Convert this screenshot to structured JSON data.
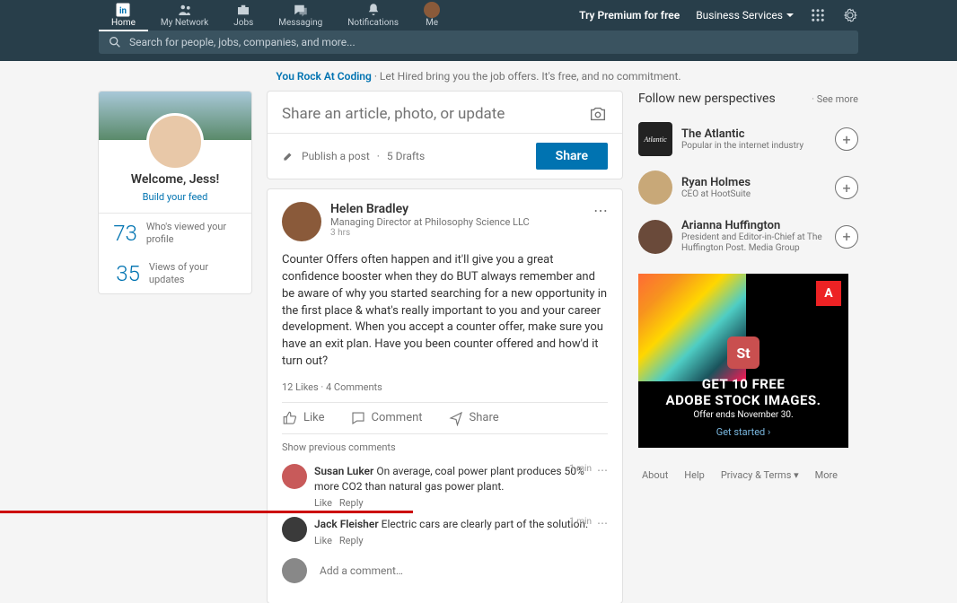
{
  "nav": {
    "home": "Home",
    "network": "My Network",
    "jobs": "Jobs",
    "messaging": "Messaging",
    "notifications": "Notifications",
    "me": "Me",
    "premium": "Try Premium for free",
    "business": "Business Services"
  },
  "search": {
    "placeholder": "Search for people, jobs, companies, and more..."
  },
  "promo": {
    "link": "You Rock At Coding",
    "text": " · Let Hired bring you the job offers. It's free, and no commitment."
  },
  "profile": {
    "welcome": "Welcome, Jess!",
    "build": "Build your feed",
    "stats": [
      {
        "num": "73",
        "label": "Who's viewed your profile"
      },
      {
        "num": "35",
        "label": "Views of your updates"
      }
    ]
  },
  "share": {
    "title": "Share an article, photo, or update",
    "publish": "Publish a post",
    "drafts": "5 Drafts",
    "button": "Share"
  },
  "post": {
    "author": "Helen Bradley",
    "headline": "Managing Director at Philosophy Science LLC",
    "time": "3 hrs",
    "body": "Counter Offers often happen and it'll give you a great confidence booster when they do BUT always remember and be aware of why you started searching for a new opportunity in the first place & what's really important to you and your career development. When you accept a counter offer, make sure you have an exit plan. Have you been counter offered and how'd it turn out?",
    "likes": "12 Likes",
    "comments_count": "4 Comments",
    "actions": {
      "like": "Like",
      "comment": "Comment",
      "share": "Share"
    },
    "prev": "Show previous comments",
    "comments": [
      {
        "author": "Susan Luker",
        "text": "On average, coal power plant produces 50% more CO2 than natural gas power plant.",
        "time": "1 min",
        "like": "Like",
        "reply": "Reply"
      },
      {
        "author": "Jack Fleisher",
        "text": "Electric cars are clearly part of the solution.",
        "time": "1 min",
        "like": "Like",
        "reply": "Reply"
      }
    ],
    "add_placeholder": "Add a comment…"
  },
  "follow": {
    "title": "Follow new perspectives",
    "see_more": "See more",
    "items": [
      {
        "name": "The Atlantic",
        "sub": "Popular in the internet industry"
      },
      {
        "name": "Ryan Holmes",
        "sub": "CEO at HootSuite"
      },
      {
        "name": "Arianna Huffington",
        "sub": "President and Editor-in-Chief at The Huffington Post. Media Group"
      }
    ]
  },
  "ad": {
    "logo": "A",
    "st": "St",
    "line1": "GET 10 FREE",
    "line2": "ADOBE STOCK IMAGES.",
    "offer": "Offer ends November 30.",
    "cta": "Get started ›"
  },
  "footer": {
    "about": "About",
    "help": "Help",
    "privacy": "Privacy & Terms",
    "more": "More"
  }
}
